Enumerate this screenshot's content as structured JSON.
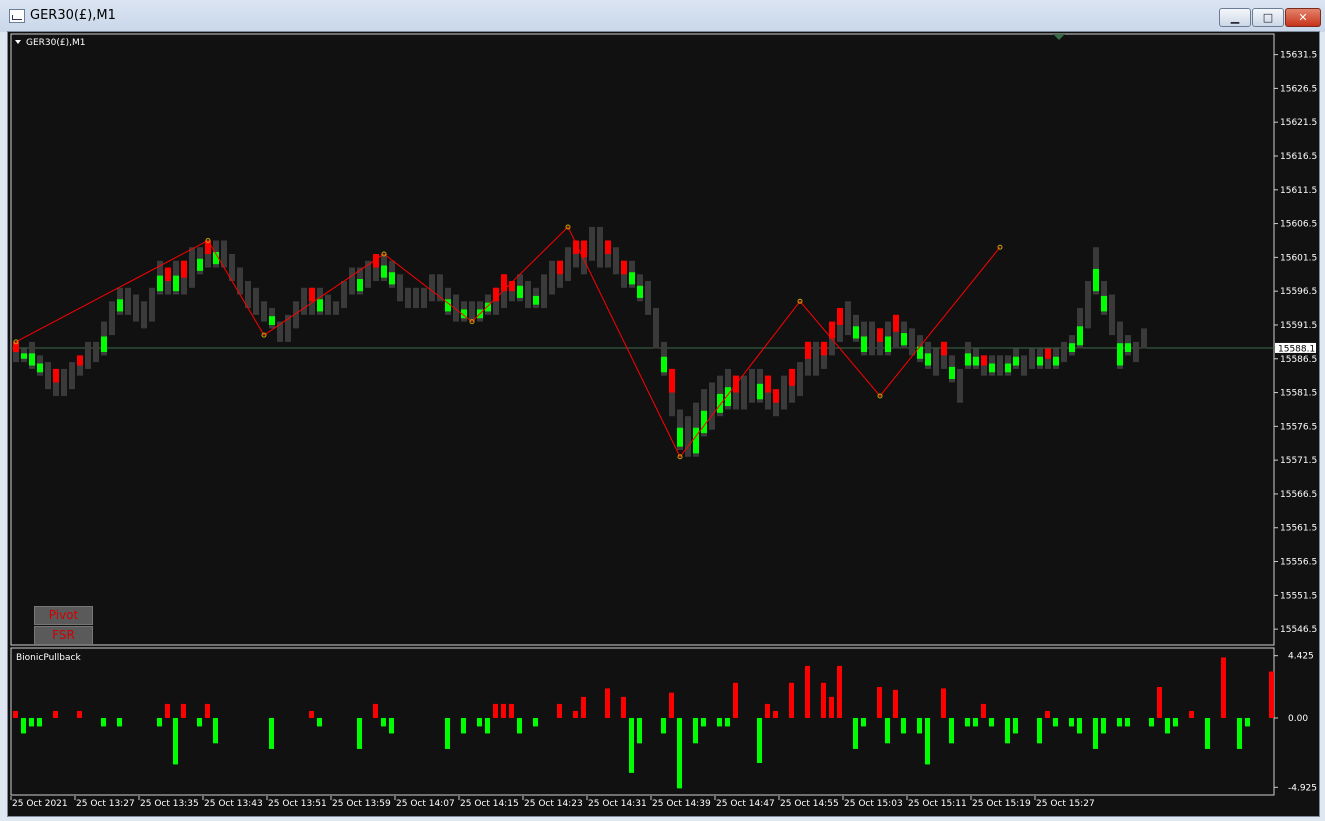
{
  "window": {
    "title": "GER30(£),M1"
  },
  "chart_label": "GER30(£),M1",
  "indicator_label": "BionicPullback",
  "buttons": {
    "pivot": "Pivot",
    "fsr": "FSR"
  },
  "colors": {
    "up": "#00ff00",
    "down": "#ff0000",
    "neutral": "#3a3a3a",
    "zigzag": "#ff0000",
    "axis_text": "#ffffff",
    "grid_line": "#3d6b4a"
  },
  "chart_data": [
    {
      "type": "candlestick",
      "title": "GER30(£),M1",
      "ylim": [
        15544.3,
        15634.4
      ],
      "y_ticks": [
        "15631.5",
        "15626.5",
        "15621.5",
        "15616.5",
        "15611.5",
        "15606.5",
        "15601.5",
        "15596.5",
        "15591.5",
        "15586.5",
        "15581.5",
        "15576.5",
        "15571.5",
        "15566.5",
        "15561.5",
        "15556.5",
        "15551.5",
        "15546.5"
      ],
      "current_price": "15588.1",
      "x_labels": [
        "25 Oct 2021",
        "25 Oct 13:27",
        "25 Oct 13:35",
        "25 Oct 13:43",
        "25 Oct 13:51",
        "25 Oct 13:59",
        "25 Oct 14:07",
        "25 Oct 14:15",
        "25 Oct 14:23",
        "25 Oct 14:31",
        "25 Oct 14:39",
        "25 Oct 14:47",
        "25 Oct 14:55",
        "25 Oct 15:03",
        "25 Oct 15:11",
        "25 Oct 15:19",
        "25 Oct 15:27"
      ],
      "bars_hl": [
        [
          15589,
          15586
        ],
        [
          15588,
          15586
        ],
        [
          15589,
          15585
        ],
        [
          15587,
          15584
        ],
        [
          15586,
          15582
        ],
        [
          15585,
          15581
        ],
        [
          15585,
          15581
        ],
        [
          15586,
          15582
        ],
        [
          15587,
          15584
        ],
        [
          15589,
          15585
        ],
        [
          15589,
          15586
        ],
        [
          15592,
          15587
        ],
        [
          15595,
          15590
        ],
        [
          15597,
          15593
        ],
        [
          15597,
          15593
        ],
        [
          15596,
          15592
        ],
        [
          15595,
          15591
        ],
        [
          15597,
          15592
        ],
        [
          15601,
          15596
        ],
        [
          15600,
          15596
        ],
        [
          15601,
          15596
        ],
        [
          15601,
          15596
        ],
        [
          15603,
          15597
        ],
        [
          15603,
          15599
        ],
        [
          15604,
          15600
        ],
        [
          15604,
          15600
        ],
        [
          15604,
          15600
        ],
        [
          15602,
          15598
        ],
        [
          15600,
          15596
        ],
        [
          15598,
          15594
        ],
        [
          15597,
          15593
        ],
        [
          15595,
          15592
        ],
        [
          15594,
          15591
        ],
        [
          15592,
          15589
        ],
        [
          15593,
          15589
        ],
        [
          15595,
          15591
        ],
        [
          15597,
          15593
        ],
        [
          15597,
          15593
        ],
        [
          15597,
          15593
        ],
        [
          15596,
          15593
        ],
        [
          15595,
          15593
        ],
        [
          15598,
          15594
        ],
        [
          15600,
          15596
        ],
        [
          15600,
          15596
        ],
        [
          15601,
          15597
        ],
        [
          15602,
          15598
        ],
        [
          15602,
          15598
        ],
        [
          15601,
          15597
        ],
        [
          15599,
          15595
        ],
        [
          15597,
          15594
        ],
        [
          15597,
          15594
        ],
        [
          15597,
          15594
        ],
        [
          15599,
          15595
        ],
        [
          15599,
          15595
        ],
        [
          15597,
          15593
        ],
        [
          15596,
          15592
        ],
        [
          15595,
          15592
        ],
        [
          15595,
          15592
        ],
        [
          15595,
          15592
        ],
        [
          15596,
          15593
        ],
        [
          15597,
          15593
        ],
        [
          15599,
          15594
        ],
        [
          15598,
          15595
        ],
        [
          15599,
          15595
        ],
        [
          15598,
          15594
        ],
        [
          15597,
          15594
        ],
        [
          15599,
          15594
        ],
        [
          15601,
          15596
        ],
        [
          15601,
          15597
        ],
        [
          15603,
          15598
        ],
        [
          15604,
          15600
        ],
        [
          15604,
          15599
        ],
        [
          15606,
          15601
        ],
        [
          15606,
          15600
        ],
        [
          15604,
          15600
        ],
        [
          15603,
          15599
        ],
        [
          15601,
          15597
        ],
        [
          15601,
          15597
        ],
        [
          15599,
          15595
        ],
        [
          15598,
          15593
        ],
        [
          15594,
          15588
        ],
        [
          15589,
          15584
        ],
        [
          15585,
          15578
        ],
        [
          15579,
          15573
        ],
        [
          15578,
          15572
        ],
        [
          15580,
          15572
        ],
        [
          15582,
          15575
        ],
        [
          15583,
          15576
        ],
        [
          15584,
          15578
        ],
        [
          15585,
          15579
        ],
        [
          15584,
          15579
        ],
        [
          15584,
          15579
        ],
        [
          15585,
          15580
        ],
        [
          15585,
          15580
        ],
        [
          15584,
          15579
        ],
        [
          15582,
          15578
        ],
        [
          15584,
          15579
        ],
        [
          15585,
          15580
        ],
        [
          15586,
          15581
        ],
        [
          15589,
          15584
        ],
        [
          15589,
          15584
        ],
        [
          15589,
          15585
        ],
        [
          15592,
          15587
        ],
        [
          15594,
          15589
        ],
        [
          15595,
          15590
        ],
        [
          15593,
          15589
        ],
        [
          15592,
          15587
        ],
        [
          15592,
          15587
        ],
        [
          15591,
          15587
        ],
        [
          15592,
          15587
        ],
        [
          15593,
          15588
        ],
        [
          15592,
          15588
        ],
        [
          15591,
          15587
        ],
        [
          15590,
          15586
        ],
        [
          15589,
          15585
        ],
        [
          15588,
          15584
        ],
        [
          15589,
          15585
        ],
        [
          15587,
          15583
        ],
        [
          15585,
          15580
        ],
        [
          15589,
          15585
        ],
        [
          15588,
          15585
        ],
        [
          15587,
          15584
        ],
        [
          15587,
          15584
        ],
        [
          15587,
          15584
        ],
        [
          15587,
          15584
        ],
        [
          15588,
          15585
        ],
        [
          15587,
          15584
        ],
        [
          15588,
          15585
        ],
        [
          15588,
          15585
        ],
        [
          15588,
          15585
        ],
        [
          15588,
          15585
        ],
        [
          15589,
          15586
        ],
        [
          15590,
          15587
        ],
        [
          15594,
          15588
        ],
        [
          15598,
          15591
        ],
        [
          15603,
          15596
        ],
        [
          15598,
          15593
        ],
        [
          15596,
          15590
        ],
        [
          15592,
          15585
        ],
        [
          15590,
          15587
        ],
        [
          15589,
          15586
        ],
        [
          15591,
          15588
        ]
      ],
      "zigzag": [
        [
          0,
          15589
        ],
        [
          24,
          15604
        ],
        [
          31,
          15590
        ],
        [
          46,
          15602
        ],
        [
          57,
          15592
        ],
        [
          69,
          15606
        ],
        [
          83,
          15572
        ],
        [
          98,
          15595
        ],
        [
          108,
          15581
        ],
        [
          123,
          15603
        ]
      ],
      "annotations": []
    },
    {
      "type": "bar",
      "title": "BionicPullback",
      "ylim": [
        -5.4,
        4.9
      ],
      "y_ticks": [
        "4.425",
        "0.00",
        "-4.925"
      ],
      "values": [
        0.5,
        -1.1,
        -0.6,
        -0.6,
        0,
        0.5,
        0,
        0,
        0.5,
        0,
        0,
        -0.6,
        0,
        -0.6,
        0,
        0,
        0,
        0,
        -0.6,
        1.0,
        -3.3,
        1.0,
        0,
        -0.6,
        1.0,
        -1.8,
        0,
        0,
        0,
        0,
        0,
        0,
        -2.2,
        0,
        0,
        0,
        0,
        0.5,
        -0.6,
        0,
        0,
        0,
        0,
        -2.2,
        0,
        1.0,
        -0.6,
        -1.1,
        0,
        0,
        0,
        0,
        0,
        0,
        -2.2,
        0,
        -1.1,
        0,
        -0.6,
        -1.1,
        1.0,
        1.0,
        1.0,
        -1.1,
        0,
        -0.6,
        0,
        0,
        1.0,
        0,
        0.5,
        1.5,
        0,
        0,
        2.1,
        0,
        1.5,
        -3.9,
        -1.8,
        0,
        0,
        -1.1,
        1.8,
        -5.0,
        0,
        -1.8,
        -0.6,
        0,
        -0.6,
        -0.6,
        2.5,
        0,
        0,
        -3.2,
        1.0,
        0.5,
        0,
        2.5,
        0,
        3.7,
        0,
        2.5,
        1.5,
        3.7,
        0,
        -2.2,
        -0.6,
        0,
        2.2,
        -1.8,
        2.0,
        -1.1,
        0,
        -1.1,
        -3.3,
        0,
        2.1,
        -1.8,
        0,
        -0.6,
        -0.6,
        1.0,
        -0.6,
        0,
        -1.8,
        -1.1,
        0,
        0,
        -1.8,
        0.5,
        -0.6,
        0,
        -0.6,
        -1.1,
        0,
        -2.2,
        -1.1,
        0,
        -0.6,
        -0.6,
        0,
        0,
        -0.6,
        2.2,
        -1.1,
        -0.6,
        0,
        0.5,
        0,
        -2.2,
        0,
        4.3,
        0,
        -2.2,
        -0.6,
        0,
        0,
        3.3
      ],
      "annotations": []
    }
  ]
}
